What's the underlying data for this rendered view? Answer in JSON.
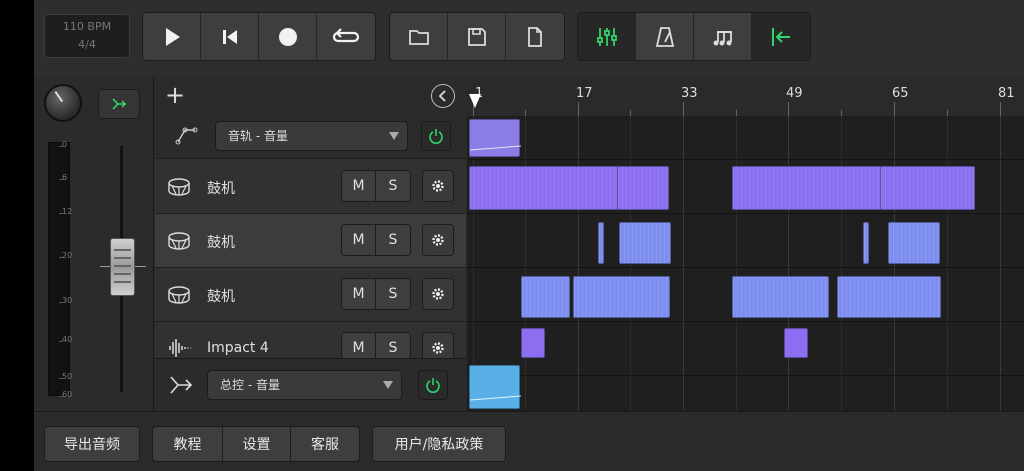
{
  "transport": {
    "bpm": "110 BPM",
    "time_signature": "4/4"
  },
  "toolbar": {
    "icons": [
      "play-icon",
      "skip-to-start-icon",
      "record-icon",
      "loop-icon",
      "folder-icon",
      "save-icon",
      "new-file-icon",
      "mixer-icon",
      "metronome-icon",
      "music-notes-icon",
      "snap-to-start-icon"
    ]
  },
  "mixer": {
    "meter_scale": [
      "0",
      "6",
      "12",
      "20",
      "30",
      "40",
      "50",
      "60"
    ],
    "fader_level_db": 20
  },
  "tracks_header": {
    "automation": {
      "selected": "音轨 - 音量"
    },
    "tracks": [
      {
        "name": "鼓机",
        "mute_label": "M",
        "solo_label": "S",
        "icon": "drum-icon"
      },
      {
        "name": "鼓机",
        "mute_label": "M",
        "solo_label": "S",
        "icon": "drum-icon",
        "selected": true
      },
      {
        "name": "鼓机",
        "mute_label": "M",
        "solo_label": "S",
        "icon": "drum-icon"
      },
      {
        "name": "Impact 4",
        "mute_label": "M",
        "solo_label": "S",
        "icon": "waveform-icon"
      }
    ],
    "master": {
      "selected": "总控 - 音量"
    }
  },
  "timeline": {
    "ruler": [
      "1",
      "17",
      "33",
      "49",
      "65",
      "81"
    ]
  },
  "bottom": {
    "export_label": "导出音频",
    "tutorial_label": "教程",
    "settings_label": "设置",
    "support_label": "客服",
    "policy_label": "用户/隐私政策"
  },
  "colors": {
    "accent_green": "#2fd46a",
    "clip_purple": "#8b6ff0",
    "clip_blue": "#7d8ef0",
    "clip_cyan": "#58b0e6"
  }
}
